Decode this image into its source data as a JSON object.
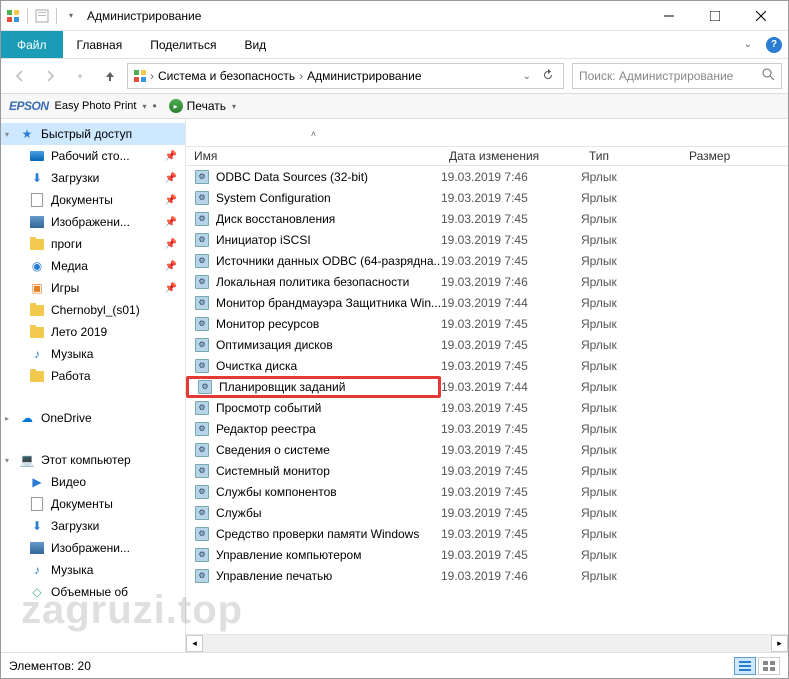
{
  "title": "Администрирование",
  "menubar": {
    "file": "Файл",
    "home": "Главная",
    "share": "Поделиться",
    "view": "Вид"
  },
  "breadcrumb": {
    "seg1": "Система и безопасность",
    "seg2": "Администрирование"
  },
  "search": {
    "placeholder": "Поиск: Администрирование"
  },
  "epson": {
    "logo": "EPSON",
    "text": "Easy Photo Print",
    "print": "Печать"
  },
  "columns": {
    "name": "Имя",
    "date": "Дата изменения",
    "type": "Тип",
    "size": "Размер"
  },
  "sidebar": {
    "quick_access": "Быстрый доступ",
    "items": [
      {
        "label": "Рабочий сто...",
        "icon": "desktop",
        "pin": true
      },
      {
        "label": "Загрузки",
        "icon": "download",
        "pin": true
      },
      {
        "label": "Документы",
        "icon": "docs",
        "pin": true
      },
      {
        "label": "Изображени...",
        "icon": "pics",
        "pin": true
      },
      {
        "label": "проги",
        "icon": "folder",
        "pin": true
      },
      {
        "label": "Медиа",
        "icon": "media",
        "pin": true
      },
      {
        "label": "Игры",
        "icon": "game",
        "pin": true
      },
      {
        "label": "Chernobyl_(s01)",
        "icon": "folder",
        "pin": false
      },
      {
        "label": "Лето 2019",
        "icon": "folder",
        "pin": false
      },
      {
        "label": "Музыка",
        "icon": "music",
        "pin": false
      },
      {
        "label": "Работа",
        "icon": "folder",
        "pin": false
      }
    ],
    "onedrive": "OneDrive",
    "this_pc": "Этот компьютер",
    "pc_items": [
      {
        "label": "Видео",
        "icon": "video"
      },
      {
        "label": "Документы",
        "icon": "docs"
      },
      {
        "label": "Загрузки",
        "icon": "download"
      },
      {
        "label": "Изображени...",
        "icon": "pics"
      },
      {
        "label": "Музыка",
        "icon": "music"
      },
      {
        "label": "Объемные об",
        "icon": "3d"
      }
    ]
  },
  "files": [
    {
      "name": "ODBC Data Sources (32-bit)",
      "date": "19.03.2019 7:46",
      "type": "Ярлык"
    },
    {
      "name": "System Configuration",
      "date": "19.03.2019 7:45",
      "type": "Ярлык"
    },
    {
      "name": "Диск восстановления",
      "date": "19.03.2019 7:45",
      "type": "Ярлык"
    },
    {
      "name": "Инициатор iSCSI",
      "date": "19.03.2019 7:45",
      "type": "Ярлык"
    },
    {
      "name": "Источники данных ODBC (64-разрядна...",
      "date": "19.03.2019 7:45",
      "type": "Ярлык"
    },
    {
      "name": "Локальная политика безопасности",
      "date": "19.03.2019 7:46",
      "type": "Ярлык"
    },
    {
      "name": "Монитор брандмауэра Защитника Win...",
      "date": "19.03.2019 7:44",
      "type": "Ярлык"
    },
    {
      "name": "Монитор ресурсов",
      "date": "19.03.2019 7:45",
      "type": "Ярлык"
    },
    {
      "name": "Оптимизация дисков",
      "date": "19.03.2019 7:45",
      "type": "Ярлык"
    },
    {
      "name": "Очистка диска",
      "date": "19.03.2019 7:45",
      "type": "Ярлык"
    },
    {
      "name": "Планировщик заданий",
      "date": "19.03.2019 7:44",
      "type": "Ярлык",
      "highlight": true
    },
    {
      "name": "Просмотр событий",
      "date": "19.03.2019 7:45",
      "type": "Ярлык"
    },
    {
      "name": "Редактор реестра",
      "date": "19.03.2019 7:45",
      "type": "Ярлык"
    },
    {
      "name": "Сведения о системе",
      "date": "19.03.2019 7:45",
      "type": "Ярлык"
    },
    {
      "name": "Системный монитор",
      "date": "19.03.2019 7:45",
      "type": "Ярлык"
    },
    {
      "name": "Службы компонентов",
      "date": "19.03.2019 7:45",
      "type": "Ярлык"
    },
    {
      "name": "Службы",
      "date": "19.03.2019 7:45",
      "type": "Ярлык"
    },
    {
      "name": "Средство проверки памяти Windows",
      "date": "19.03.2019 7:45",
      "type": "Ярлык"
    },
    {
      "name": "Управление компьютером",
      "date": "19.03.2019 7:45",
      "type": "Ярлык"
    },
    {
      "name": "Управление печатью",
      "date": "19.03.2019 7:46",
      "type": "Ярлык"
    }
  ],
  "status": {
    "count": "Элементов: 20"
  },
  "watermark": "zagruzi.top"
}
